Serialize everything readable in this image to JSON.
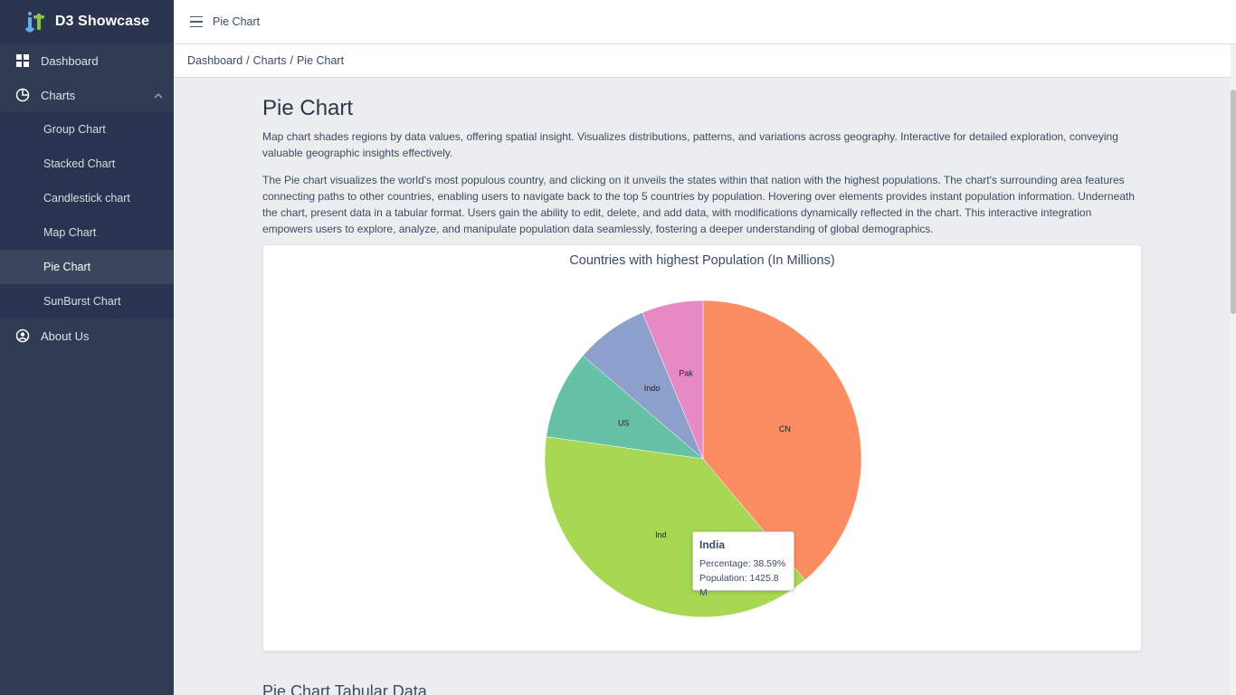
{
  "brand": {
    "name": "D3 Showcase"
  },
  "sidebar": {
    "items": [
      {
        "label": "Dashboard",
        "icon": "dashboard-icon"
      },
      {
        "label": "Charts",
        "icon": "chart-pie-icon"
      },
      {
        "label": "About Us",
        "icon": "user-circle-icon"
      }
    ],
    "sub_items": [
      {
        "label": "Group Chart"
      },
      {
        "label": "Stacked Chart"
      },
      {
        "label": "Candlestick chart"
      },
      {
        "label": "Map Chart"
      },
      {
        "label": "Pie Chart"
      },
      {
        "label": "SunBurst Chart"
      }
    ]
  },
  "header": {
    "title": "Pie Chart"
  },
  "breadcrumb": {
    "items": [
      "Dashboard",
      "Charts",
      "Pie Chart"
    ]
  },
  "page": {
    "title": "Pie Chart",
    "para1": "Map chart shades regions by data values, offering spatial insight. Visualizes distributions, patterns, and variations across geography. Interactive for detailed exploration, conveying valuable geographic insights effectively.",
    "para2": "The Pie chart visualizes the world's most populous country, and clicking on it unveils the states within that nation with the highest populations. The chart's surrounding area features connecting paths to other countries, enabling users to navigate back to the top 5 countries by population. Hovering over elements provides instant population information. Underneath the chart, present data in a tabular format. Users gain the ability to edit, delete, and add data, with modifications dynamically reflected in the chart. This interactive integration empowers users to explore, analyze, and manipulate population data seamlessly, fostering a deeper understanding of global demographics.",
    "table_section_title": "Pie Chart Tabular Data"
  },
  "tooltip": {
    "title": "India",
    "percentage": "Percentage: 38.59%",
    "population": "Population: 1425.8 M"
  },
  "chart_data": {
    "type": "pie",
    "title": "Countries with highest Population (In Millions)",
    "slices": [
      {
        "label": "CN",
        "value": 39.1,
        "color": "#fc8d62"
      },
      {
        "label": "Ind",
        "value": 38.59,
        "color": "#a6d854"
      },
      {
        "label": "US",
        "value": 9.1,
        "color": "#66c2a5"
      },
      {
        "label": "Indo",
        "value": 7.5,
        "color": "#8da0cb"
      },
      {
        "label": "Pak",
        "value": 6.3,
        "color": "#e78ac3"
      }
    ]
  }
}
